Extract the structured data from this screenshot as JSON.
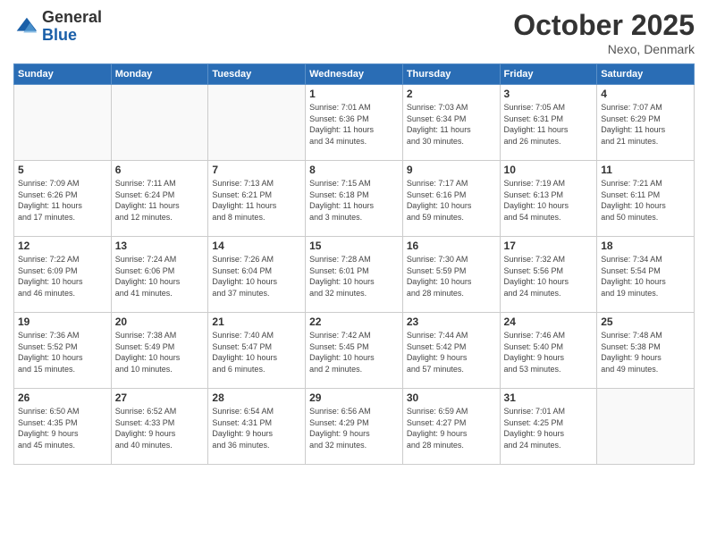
{
  "header": {
    "logo_line1": "General",
    "logo_line2": "Blue",
    "month": "October 2025",
    "location": "Nexo, Denmark"
  },
  "weekdays": [
    "Sunday",
    "Monday",
    "Tuesday",
    "Wednesday",
    "Thursday",
    "Friday",
    "Saturday"
  ],
  "weeks": [
    [
      {
        "day": "",
        "info": ""
      },
      {
        "day": "",
        "info": ""
      },
      {
        "day": "",
        "info": ""
      },
      {
        "day": "1",
        "info": "Sunrise: 7:01 AM\nSunset: 6:36 PM\nDaylight: 11 hours\nand 34 minutes."
      },
      {
        "day": "2",
        "info": "Sunrise: 7:03 AM\nSunset: 6:34 PM\nDaylight: 11 hours\nand 30 minutes."
      },
      {
        "day": "3",
        "info": "Sunrise: 7:05 AM\nSunset: 6:31 PM\nDaylight: 11 hours\nand 26 minutes."
      },
      {
        "day": "4",
        "info": "Sunrise: 7:07 AM\nSunset: 6:29 PM\nDaylight: 11 hours\nand 21 minutes."
      }
    ],
    [
      {
        "day": "5",
        "info": "Sunrise: 7:09 AM\nSunset: 6:26 PM\nDaylight: 11 hours\nand 17 minutes."
      },
      {
        "day": "6",
        "info": "Sunrise: 7:11 AM\nSunset: 6:24 PM\nDaylight: 11 hours\nand 12 minutes."
      },
      {
        "day": "7",
        "info": "Sunrise: 7:13 AM\nSunset: 6:21 PM\nDaylight: 11 hours\nand 8 minutes."
      },
      {
        "day": "8",
        "info": "Sunrise: 7:15 AM\nSunset: 6:18 PM\nDaylight: 11 hours\nand 3 minutes."
      },
      {
        "day": "9",
        "info": "Sunrise: 7:17 AM\nSunset: 6:16 PM\nDaylight: 10 hours\nand 59 minutes."
      },
      {
        "day": "10",
        "info": "Sunrise: 7:19 AM\nSunset: 6:13 PM\nDaylight: 10 hours\nand 54 minutes."
      },
      {
        "day": "11",
        "info": "Sunrise: 7:21 AM\nSunset: 6:11 PM\nDaylight: 10 hours\nand 50 minutes."
      }
    ],
    [
      {
        "day": "12",
        "info": "Sunrise: 7:22 AM\nSunset: 6:09 PM\nDaylight: 10 hours\nand 46 minutes."
      },
      {
        "day": "13",
        "info": "Sunrise: 7:24 AM\nSunset: 6:06 PM\nDaylight: 10 hours\nand 41 minutes."
      },
      {
        "day": "14",
        "info": "Sunrise: 7:26 AM\nSunset: 6:04 PM\nDaylight: 10 hours\nand 37 minutes."
      },
      {
        "day": "15",
        "info": "Sunrise: 7:28 AM\nSunset: 6:01 PM\nDaylight: 10 hours\nand 32 minutes."
      },
      {
        "day": "16",
        "info": "Sunrise: 7:30 AM\nSunset: 5:59 PM\nDaylight: 10 hours\nand 28 minutes."
      },
      {
        "day": "17",
        "info": "Sunrise: 7:32 AM\nSunset: 5:56 PM\nDaylight: 10 hours\nand 24 minutes."
      },
      {
        "day": "18",
        "info": "Sunrise: 7:34 AM\nSunset: 5:54 PM\nDaylight: 10 hours\nand 19 minutes."
      }
    ],
    [
      {
        "day": "19",
        "info": "Sunrise: 7:36 AM\nSunset: 5:52 PM\nDaylight: 10 hours\nand 15 minutes."
      },
      {
        "day": "20",
        "info": "Sunrise: 7:38 AM\nSunset: 5:49 PM\nDaylight: 10 hours\nand 10 minutes."
      },
      {
        "day": "21",
        "info": "Sunrise: 7:40 AM\nSunset: 5:47 PM\nDaylight: 10 hours\nand 6 minutes."
      },
      {
        "day": "22",
        "info": "Sunrise: 7:42 AM\nSunset: 5:45 PM\nDaylight: 10 hours\nand 2 minutes."
      },
      {
        "day": "23",
        "info": "Sunrise: 7:44 AM\nSunset: 5:42 PM\nDaylight: 9 hours\nand 57 minutes."
      },
      {
        "day": "24",
        "info": "Sunrise: 7:46 AM\nSunset: 5:40 PM\nDaylight: 9 hours\nand 53 minutes."
      },
      {
        "day": "25",
        "info": "Sunrise: 7:48 AM\nSunset: 5:38 PM\nDaylight: 9 hours\nand 49 minutes."
      }
    ],
    [
      {
        "day": "26",
        "info": "Sunrise: 6:50 AM\nSunset: 4:35 PM\nDaylight: 9 hours\nand 45 minutes."
      },
      {
        "day": "27",
        "info": "Sunrise: 6:52 AM\nSunset: 4:33 PM\nDaylight: 9 hours\nand 40 minutes."
      },
      {
        "day": "28",
        "info": "Sunrise: 6:54 AM\nSunset: 4:31 PM\nDaylight: 9 hours\nand 36 minutes."
      },
      {
        "day": "29",
        "info": "Sunrise: 6:56 AM\nSunset: 4:29 PM\nDaylight: 9 hours\nand 32 minutes."
      },
      {
        "day": "30",
        "info": "Sunrise: 6:59 AM\nSunset: 4:27 PM\nDaylight: 9 hours\nand 28 minutes."
      },
      {
        "day": "31",
        "info": "Sunrise: 7:01 AM\nSunset: 4:25 PM\nDaylight: 9 hours\nand 24 minutes."
      },
      {
        "day": "",
        "info": ""
      }
    ]
  ]
}
